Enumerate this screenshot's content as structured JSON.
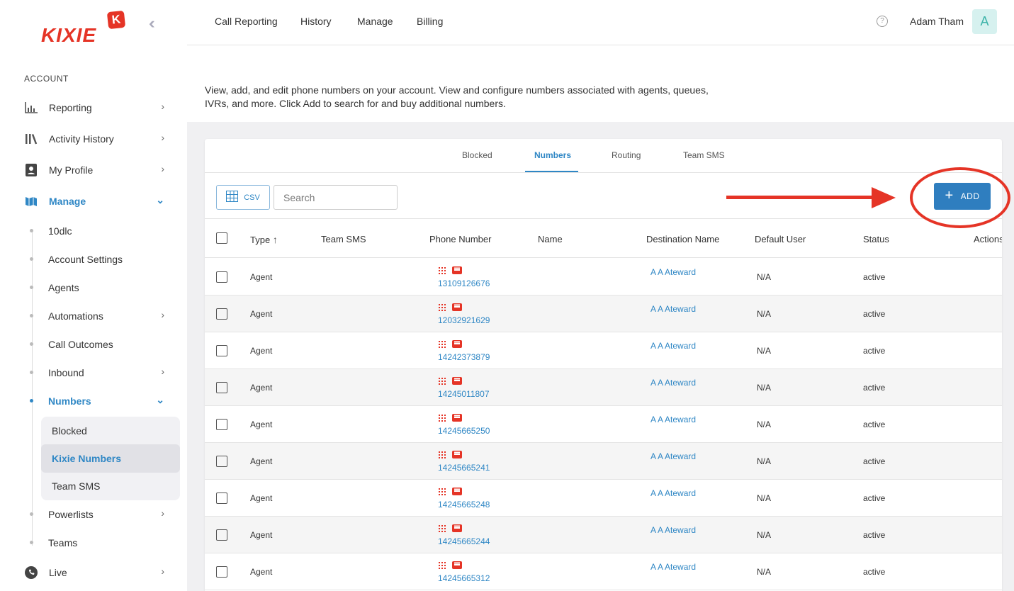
{
  "brand": {
    "name": "KIXIE",
    "badge": "K",
    "color": "#e53426"
  },
  "sidebar": {
    "section": "ACCOUNT",
    "items": [
      {
        "label": "Reporting",
        "icon": "bar-chart-icon"
      },
      {
        "label": "Activity History",
        "icon": "library-icon"
      },
      {
        "label": "My Profile",
        "icon": "profile-icon"
      },
      {
        "label": "Manage",
        "icon": "map-icon"
      }
    ],
    "manage_items": [
      "10dlc",
      "Account Settings",
      "Agents",
      "Automations",
      "Call Outcomes",
      "Inbound",
      "Numbers",
      "Powerlists",
      "Teams"
    ],
    "numbers_items": [
      "Blocked",
      "Kixie Numbers",
      "Team SMS"
    ],
    "live": {
      "label": "Live",
      "icon": "phone-icon"
    }
  },
  "topnav": [
    "Call Reporting",
    "History",
    "Manage",
    "Billing"
  ],
  "user": {
    "name": "Adam Tham",
    "initial": "A"
  },
  "description": "View, add, and edit phone numbers on your account. View and configure numbers associated with agents, queues, IVRs, and more. Click Add to search for and buy additional numbers.",
  "tabs": [
    "Blocked",
    "Numbers",
    "Routing",
    "Team SMS"
  ],
  "toolbar": {
    "csv_label": "CSV",
    "search_placeholder": "Search",
    "add_label": "ADD"
  },
  "table": {
    "columns": [
      "Type",
      "Team SMS",
      "Phone Number",
      "Name",
      "Destination Name",
      "Default User",
      "Status",
      "Actions"
    ],
    "rows": [
      {
        "type": "Agent",
        "phone": "13109126676",
        "dest": "A A Ateward",
        "user": "N/A",
        "status": "active"
      },
      {
        "type": "Agent",
        "phone": "12032921629",
        "dest": "A A Ateward",
        "user": "N/A",
        "status": "active"
      },
      {
        "type": "Agent",
        "phone": "14242373879",
        "dest": "A A Ateward",
        "user": "N/A",
        "status": "active"
      },
      {
        "type": "Agent",
        "phone": "14245011807",
        "dest": "A A Ateward",
        "user": "N/A",
        "status": "active"
      },
      {
        "type": "Agent",
        "phone": "14245665250",
        "dest": "A A Ateward",
        "user": "N/A",
        "status": "active"
      },
      {
        "type": "Agent",
        "phone": "14245665241",
        "dest": "A A Ateward",
        "user": "N/A",
        "status": "active"
      },
      {
        "type": "Agent",
        "phone": "14245665248",
        "dest": "A A Ateward",
        "user": "N/A",
        "status": "active"
      },
      {
        "type": "Agent",
        "phone": "14245665244",
        "dest": "A A Ateward",
        "user": "N/A",
        "status": "active"
      },
      {
        "type": "Agent",
        "phone": "14245665312",
        "dest": "A A Ateward",
        "user": "N/A",
        "status": "active"
      }
    ]
  }
}
